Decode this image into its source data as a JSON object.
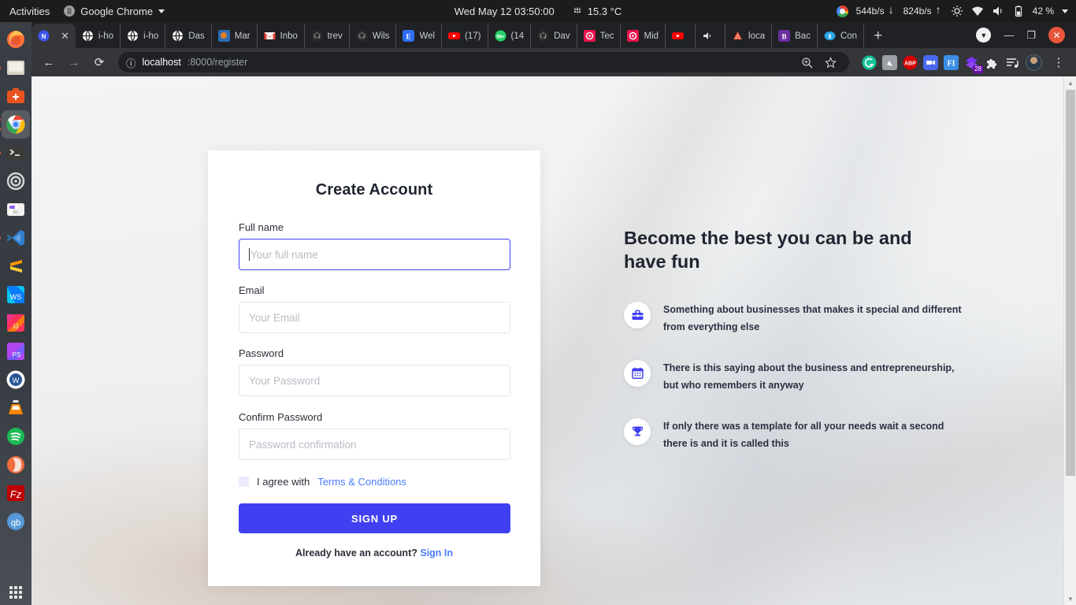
{
  "topbar": {
    "activities": "Activities",
    "app_name": "Google Chrome",
    "clock": "Wed May 12  03:50:00",
    "temperature": "15.3 °C",
    "download_rate": "544b/s",
    "upload_rate": "824b/s",
    "battery": "42 %"
  },
  "dock": {
    "items": [
      {
        "name": "firefox",
        "label": "Firefox"
      },
      {
        "name": "files",
        "label": "Files"
      },
      {
        "name": "ubuntu-software",
        "label": "Ubuntu Software"
      },
      {
        "name": "google-chrome",
        "label": "Google Chrome"
      },
      {
        "name": "terminal",
        "label": "Terminal"
      },
      {
        "name": "settings",
        "label": "Settings"
      },
      {
        "name": "gnome-tweaks",
        "label": "Tweaks"
      },
      {
        "name": "vs-code",
        "label": "Visual Studio Code"
      },
      {
        "name": "sublime-text",
        "label": "Sublime Text"
      },
      {
        "name": "webstorm",
        "label": "WebStorm"
      },
      {
        "name": "intellij-idea",
        "label": "IntelliJ IDEA"
      },
      {
        "name": "phpstorm",
        "label": "PhpStorm"
      },
      {
        "name": "word",
        "label": "Word"
      },
      {
        "name": "vlc",
        "label": "VLC"
      },
      {
        "name": "spotify",
        "label": "Spotify"
      },
      {
        "name": "opera",
        "label": "Opera"
      },
      {
        "name": "filezilla",
        "label": "FileZilla"
      },
      {
        "name": "qbittorrent",
        "label": "qBittorrent"
      }
    ],
    "show_apps": "Show Applications"
  },
  "browser": {
    "tabs": [
      {
        "title": "",
        "favicon": "nuxt",
        "active": true
      },
      {
        "title": "i-ho",
        "favicon": "globe",
        "active": false
      },
      {
        "title": "i-ho",
        "favicon": "globe",
        "active": false
      },
      {
        "title": "Das",
        "favicon": "globe",
        "active": false
      },
      {
        "title": "Mar",
        "favicon": "image",
        "active": false
      },
      {
        "title": "Inbo",
        "favicon": "gmail",
        "active": false
      },
      {
        "title": "trev",
        "favicon": "github",
        "active": false
      },
      {
        "title": "Wils",
        "favicon": "github",
        "active": false
      },
      {
        "title": "Wel",
        "favicon": "evernote",
        "active": false
      },
      {
        "title": "(17)",
        "favicon": "youtube",
        "active": false
      },
      {
        "title": "(14",
        "favicon": "whatsapp",
        "active": false
      },
      {
        "title": "Dav",
        "favicon": "github",
        "active": false
      },
      {
        "title": "Tec",
        "favicon": "crunchbase",
        "active": false
      },
      {
        "title": "Mid",
        "favicon": "crunchbase",
        "active": false
      },
      {
        "title": "",
        "favicon": "youtube",
        "active": false
      },
      {
        "title": "",
        "favicon": "speaker",
        "active": false
      },
      {
        "title": "loca",
        "favicon": "laravel",
        "active": false
      },
      {
        "title": "Bac",
        "favicon": "bitwarden",
        "active": false
      },
      {
        "title": "Con",
        "favicon": "coin",
        "active": false
      }
    ],
    "new_tab": "+",
    "window_controls": {
      "dropdown": "▼",
      "minimize": "—",
      "maximize": "❐",
      "close": "✕"
    },
    "nav": {
      "back": "←",
      "forward": "→",
      "reload": "⟳"
    },
    "omnibox": {
      "info_icon": "ⓘ",
      "host": "localhost",
      "path": ":8000/register",
      "zoom_icon": "zoom-in-icon",
      "bookmark_icon": "star-icon"
    },
    "extensions": [
      {
        "name": "grammarly-extension",
        "label": "G"
      },
      {
        "name": "screenshot-extension",
        "label": ""
      },
      {
        "name": "adblock-plus-extension",
        "label": "ABP"
      },
      {
        "name": "zoom-extension",
        "label": ""
      },
      {
        "name": "fonts-extension",
        "label": "FI"
      },
      {
        "name": "downloads-extension",
        "label": "28"
      },
      {
        "name": "puzzle-extension",
        "label": ""
      },
      {
        "name": "media-list-extension",
        "label": ""
      },
      {
        "name": "profile-avatar",
        "label": ""
      },
      {
        "name": "chrome-menu",
        "label": "⋮"
      }
    ]
  },
  "page": {
    "form": {
      "title": "Create Account",
      "fields": [
        {
          "label": "Full name",
          "placeholder": "Your full name",
          "value": "",
          "focused": true,
          "name": "full-name"
        },
        {
          "label": "Email",
          "placeholder": "Your Email",
          "value": "",
          "focused": false,
          "name": "email"
        },
        {
          "label": "Password",
          "placeholder": "Your Password",
          "value": "",
          "focused": false,
          "name": "password"
        },
        {
          "label": "Confirm Password",
          "placeholder": "Password confirmation",
          "value": "",
          "focused": false,
          "name": "confirm-password"
        }
      ],
      "agree_text": "I agree with",
      "terms_link": "Terms & Conditions",
      "agree_checked": false,
      "submit_label": "SIGN UP",
      "signin_prompt": "Already have an account?",
      "signin_link": "Sign In"
    },
    "promo": {
      "title": "Become the best you can be and have fun",
      "features": [
        {
          "icon": "briefcase-icon",
          "text": "Something about businesses that makes it special and different from everything else"
        },
        {
          "icon": "calendar-icon",
          "text": "There is this saying about the business and entrepreneurship, but who remembers it anyway"
        },
        {
          "icon": "trophy-icon",
          "text": "If only there was a template for all your needs wait a second there is and it is called this"
        }
      ]
    }
  },
  "colors": {
    "accent": "#4040f2",
    "link": "#4a7dfc",
    "checkbox_bg": "#eceafc",
    "card_bg": "#ffffff",
    "page_bg": "#eceef0"
  }
}
